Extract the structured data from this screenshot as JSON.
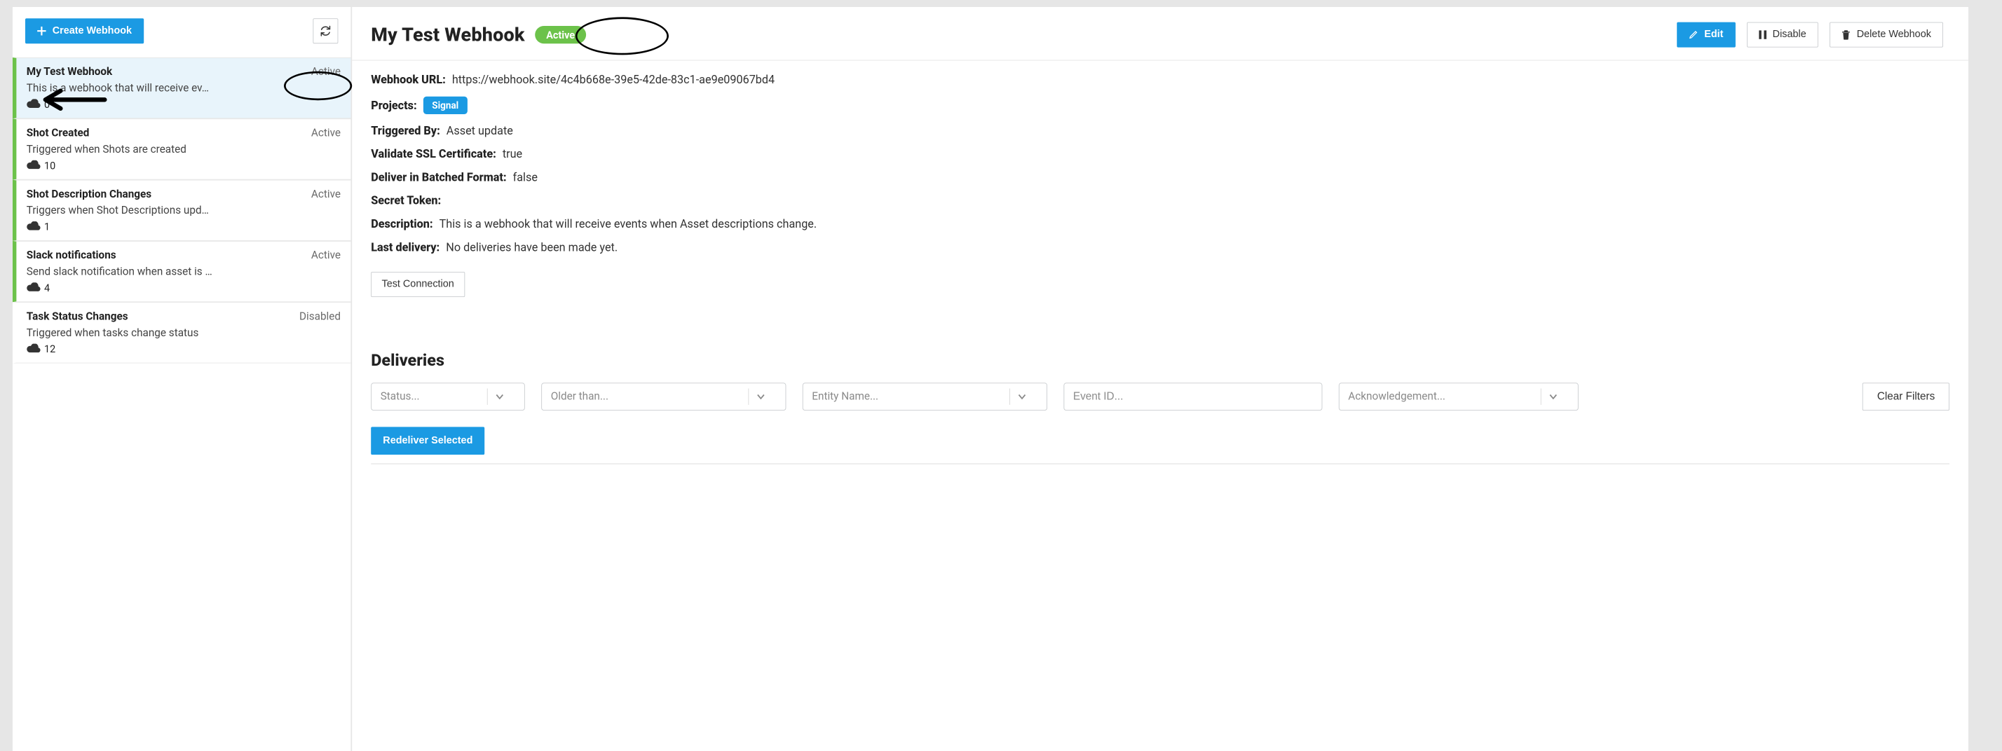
{
  "sidebar": {
    "create_label": "Create Webhook",
    "items": [
      {
        "title": "My Test Webhook",
        "status": "Active",
        "desc": "This is a webhook that will receive ev…",
        "count": "0",
        "active": true,
        "selected": true
      },
      {
        "title": "Shot Created",
        "status": "Active",
        "desc": "Triggered when Shots are created",
        "count": "10",
        "active": true,
        "selected": false
      },
      {
        "title": "Shot Description Changes",
        "status": "Active",
        "desc": "Triggers when Shot Descriptions upd…",
        "count": "1",
        "active": true,
        "selected": false
      },
      {
        "title": "Slack notifications",
        "status": "Active",
        "desc": "Send slack notification when asset is …",
        "count": "4",
        "active": true,
        "selected": false
      },
      {
        "title": "Task Status Changes",
        "status": "Disabled",
        "desc": "Triggered when tasks change status",
        "count": "12",
        "active": false,
        "selected": false
      }
    ]
  },
  "header": {
    "title": "My Test Webhook",
    "badge": "Active",
    "edit": "Edit",
    "disable": "Disable",
    "delete": "Delete Webhook"
  },
  "details": {
    "url_label": "Webhook URL:",
    "url": "https://webhook.site/4c4b668e-39e5-42de-83c1-ae9e09067bd4",
    "projects_label": "Projects:",
    "project_chip": "Signal",
    "triggered_label": "Triggered By:",
    "triggered": "Asset update",
    "ssl_label": "Validate SSL Certificate:",
    "ssl": "true",
    "batched_label": "Deliver in Batched Format:",
    "batched": "false",
    "secret_label": "Secret Token:",
    "secret": "",
    "desc_label": "Description:",
    "desc": "This is a webhook that will receive events when Asset descriptions change.",
    "last_label": "Last delivery:",
    "last": "No deliveries have been made yet.",
    "test_btn": "Test Connection"
  },
  "deliveries": {
    "title": "Deliveries",
    "status_ph": "Status...",
    "older_ph": "Older than...",
    "entity_ph": "Entity Name...",
    "event_ph": "Event ID...",
    "ack_ph": "Acknowledgement...",
    "clear": "Clear Filters",
    "redeliver": "Redeliver Selected"
  }
}
